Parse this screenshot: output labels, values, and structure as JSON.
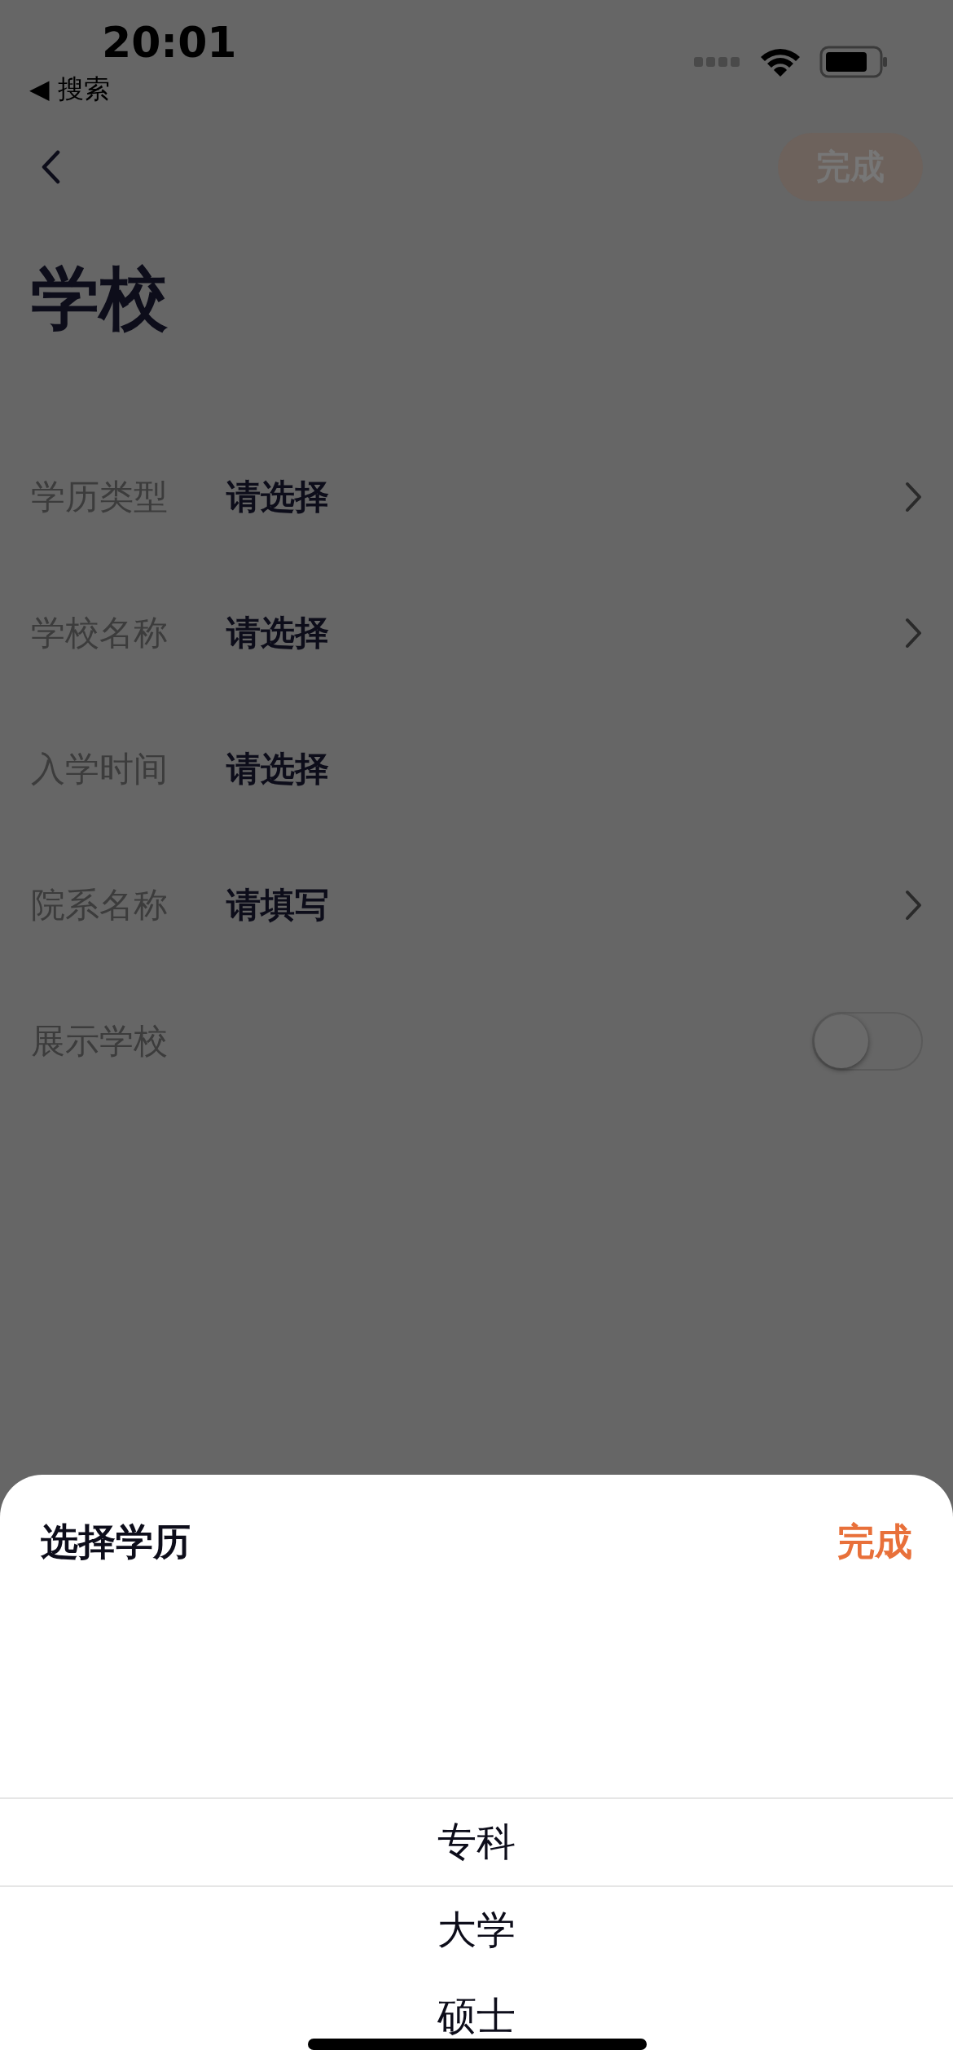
{
  "status_bar": {
    "time": "20:01",
    "back_app": "◀ 搜索"
  },
  "nav": {
    "done_button": {
      "label": "完成",
      "disabled": true
    }
  },
  "title": "学校",
  "rows": [
    {
      "kind": "select",
      "label": "学历类型",
      "value": "请选择",
      "chevron": true
    },
    {
      "kind": "select",
      "label": "学校名称",
      "value": "请选择",
      "chevron": true
    },
    {
      "kind": "select",
      "label": "入学时间",
      "value": "请选择",
      "chevron": false
    },
    {
      "kind": "select",
      "label": "院系名称",
      "value": "请填写",
      "chevron": true
    },
    {
      "kind": "toggle",
      "label": "展示学校",
      "on": false
    }
  ],
  "sheet": {
    "title": "选择学历",
    "done": "完成",
    "options": [
      {
        "label": "专科",
        "selected": true
      },
      {
        "label": "大学",
        "selected": false
      },
      {
        "label": "硕士",
        "selected": false
      }
    ]
  }
}
